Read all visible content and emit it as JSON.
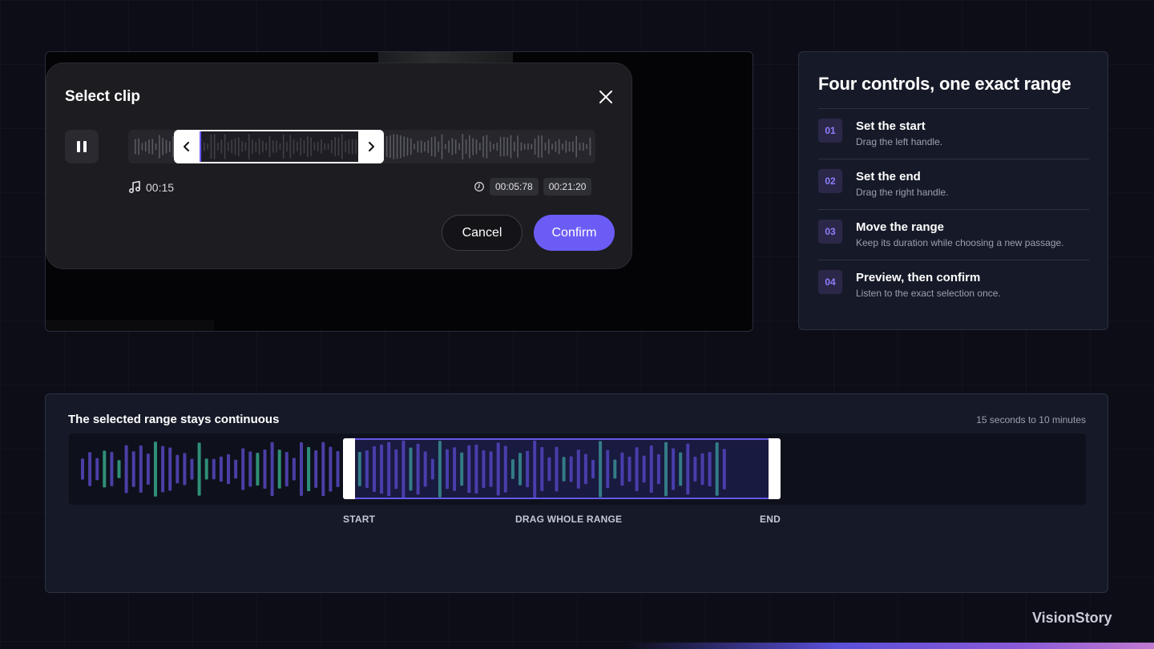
{
  "modal": {
    "title": "Select clip",
    "duration": "00:15",
    "start_time": "00:05:78",
    "end_time": "00:21:20",
    "cancel_label": "Cancel",
    "confirm_label": "Confirm"
  },
  "steps_panel": {
    "title": "Four controls, one exact range",
    "steps": [
      {
        "num": "01",
        "title": "Set the start",
        "desc": "Drag the left handle."
      },
      {
        "num": "02",
        "title": "Set the end",
        "desc": "Drag the right handle."
      },
      {
        "num": "03",
        "title": "Move the range",
        "desc": "Keep its duration while choosing a new passage."
      },
      {
        "num": "04",
        "title": "Preview, then confirm",
        "desc": "Listen to the exact selection once."
      }
    ]
  },
  "range_demo": {
    "title": "The selected range stays continuous",
    "range_note": "15 seconds to 10 minutes",
    "start_label": "START",
    "drag_label": "DRAG WHOLE RANGE",
    "end_label": "END"
  },
  "brand": "VisionStory",
  "colors": {
    "accent": "#6c5cf6",
    "waveform_purple": "#4a3fa6",
    "waveform_green": "#2f8f77"
  }
}
